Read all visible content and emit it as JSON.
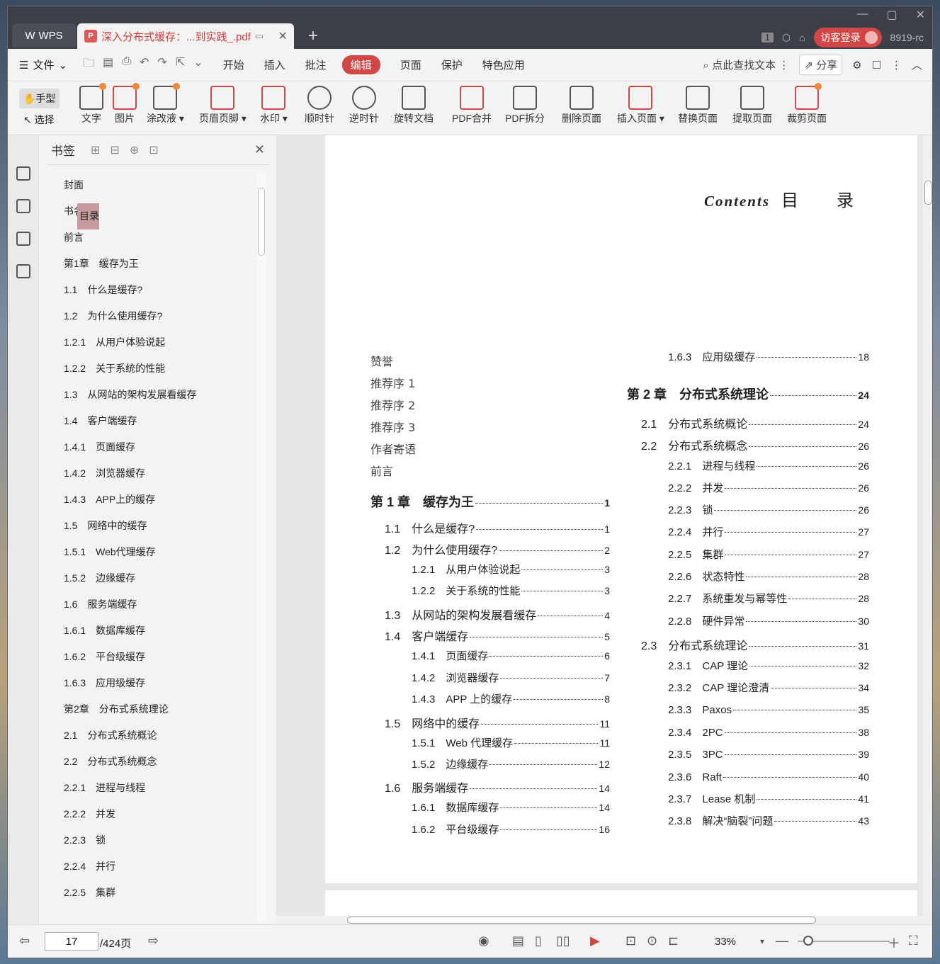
{
  "tabs": {
    "app": "WPS",
    "doc": "深入分布式缓存：...到实践_.pdf",
    "badge": "1",
    "login": "访客登录",
    "user": "8919-rc"
  },
  "menu": {
    "file": "文件",
    "items": [
      "开始",
      "插入",
      "批注",
      "编辑",
      "页面",
      "保护",
      "特色应用"
    ],
    "active": "编辑",
    "search": "点此查找文本",
    "share": "分享"
  },
  "toolbar": {
    "hand": "手型",
    "select": "选择",
    "tools": [
      "文字",
      "图片",
      "涂改液",
      "页眉页脚",
      "水印",
      "顺时针",
      "逆时针",
      "旋转文档",
      "PDF合并",
      "PDF拆分",
      "删除页面",
      "插入页面",
      "替换页面",
      "提取页面",
      "裁剪页面"
    ]
  },
  "bookmark": {
    "title": "书签",
    "items": [
      "封面",
      "书名",
      "前言",
      "目录",
      "第1章　缓存为王",
      "1.1　什么是缓存?",
      "1.2　为什么使用缓存?",
      "1.2.1　从用户体验说起",
      "1.2.2　关于系统的性能",
      "1.3　从网站的架构发展看缓存",
      "1.4　客户端缓存",
      "1.4.1　页面缓存",
      "1.4.2　浏览器缓存",
      "1.4.3　APP上的缓存",
      "1.5　网络中的缓存",
      "1.5.1　Web代理缓存",
      "1.5.2　边缘缓存",
      "1.6　服务端缓存",
      "1.6.1　数据库缓存",
      "1.6.2　平台级缓存",
      "1.6.3　应用级缓存",
      "第2章　分布式系统理论",
      "2.1　分布式系统概论",
      "2.2　分布式系统概念",
      "2.2.1　进程与线程",
      "2.2.2　并发",
      "2.2.3　锁",
      "2.2.4　并行",
      "2.2.5　集群"
    ],
    "selected": 3
  },
  "page": {
    "heading_en": "Contents",
    "heading_cn": "目　　录",
    "front": [
      "赞誉",
      "推荐序 1",
      "推荐序 2",
      "推荐序 3",
      "作者寄语",
      "前言"
    ],
    "left": [
      {
        "l": "第 1 章　缓存为王",
        "p": "1",
        "k": "ch"
      },
      {
        "l": "1.1　什么是缓存?",
        "p": "1",
        "k": "sec"
      },
      {
        "l": "1.2　为什么使用缓存?",
        "p": "2",
        "k": "sec"
      },
      {
        "l": "1.2.1　从用户体验说起",
        "p": "3",
        "k": "sub"
      },
      {
        "l": "1.2.2　关于系统的性能",
        "p": "3",
        "k": "sub"
      },
      {
        "l": "1.3　从网站的架构发展看缓存",
        "p": "4",
        "k": "sec"
      },
      {
        "l": "1.4　客户端缓存",
        "p": "5",
        "k": "sec"
      },
      {
        "l": "1.4.1　页面缓存",
        "p": "6",
        "k": "sub"
      },
      {
        "l": "1.4.2　浏览器缓存",
        "p": "7",
        "k": "sub"
      },
      {
        "l": "1.4.3　APP 上的缓存",
        "p": "8",
        "k": "sub"
      },
      {
        "l": "1.5　网络中的缓存",
        "p": "11",
        "k": "sec"
      },
      {
        "l": "1.5.1　Web 代理缓存",
        "p": "11",
        "k": "sub"
      },
      {
        "l": "1.5.2　边缘缓存",
        "p": "12",
        "k": "sub"
      },
      {
        "l": "1.6　服务端缓存",
        "p": "14",
        "k": "sec"
      },
      {
        "l": "1.6.1　数据库缓存",
        "p": "14",
        "k": "sub"
      },
      {
        "l": "1.6.2　平台级缓存",
        "p": "16",
        "k": "sub"
      }
    ],
    "right": [
      {
        "l": "1.6.3　应用级缓存",
        "p": "18",
        "k": "sub"
      },
      {
        "l": "第 2 章　分布式系统理论",
        "p": "24",
        "k": "ch"
      },
      {
        "l": "2.1　分布式系统概论",
        "p": "24",
        "k": "sec"
      },
      {
        "l": "2.2　分布式系统概念",
        "p": "26",
        "k": "sec"
      },
      {
        "l": "2.2.1　进程与线程",
        "p": "26",
        "k": "sub"
      },
      {
        "l": "2.2.2　并发",
        "p": "26",
        "k": "sub"
      },
      {
        "l": "2.2.3　锁",
        "p": "26",
        "k": "sub"
      },
      {
        "l": "2.2.4　并行",
        "p": "27",
        "k": "sub"
      },
      {
        "l": "2.2.5　集群",
        "p": "27",
        "k": "sub"
      },
      {
        "l": "2.2.6　状态特性",
        "p": "28",
        "k": "sub"
      },
      {
        "l": "2.2.7　系统重发与幂等性",
        "p": "28",
        "k": "sub"
      },
      {
        "l": "2.2.8　硬件异常",
        "p": "30",
        "k": "sub"
      },
      {
        "l": "2.3　分布式系统理论",
        "p": "31",
        "k": "sec"
      },
      {
        "l": "2.3.1　CAP 理论",
        "p": "32",
        "k": "sub"
      },
      {
        "l": "2.3.2　CAP 理论澄清",
        "p": "34",
        "k": "sub"
      },
      {
        "l": "2.3.3　Paxos",
        "p": "35",
        "k": "sub"
      },
      {
        "l": "2.3.4　2PC",
        "p": "38",
        "k": "sub"
      },
      {
        "l": "2.3.5　3PC",
        "p": "39",
        "k": "sub"
      },
      {
        "l": "2.3.6　Raft",
        "p": "40",
        "k": "sub"
      },
      {
        "l": "2.3.7　Lease 机制",
        "p": "41",
        "k": "sub"
      },
      {
        "l": "2.3.8　解决“脑裂”问题",
        "p": "43",
        "k": "sub"
      }
    ]
  },
  "status": {
    "page": "17",
    "total": "/424页",
    "zoom": "33%"
  }
}
